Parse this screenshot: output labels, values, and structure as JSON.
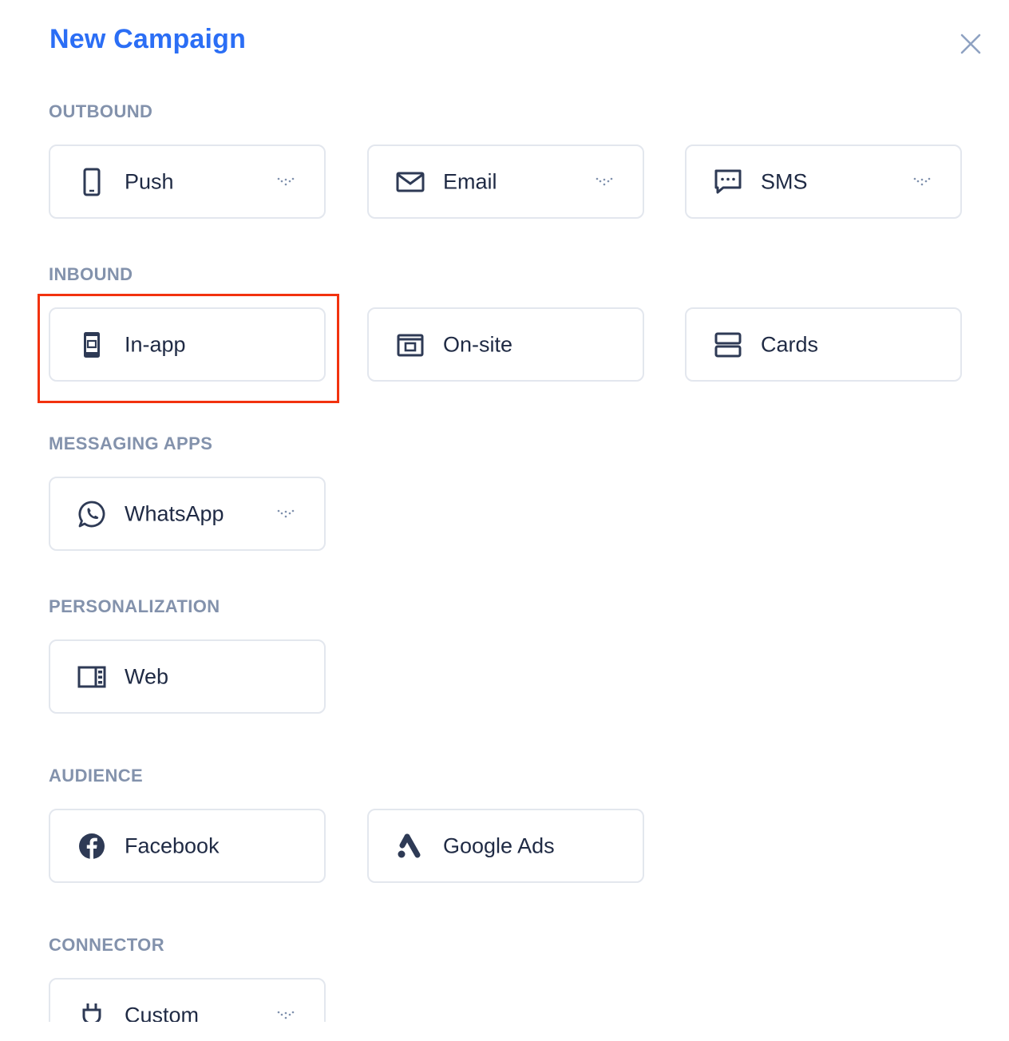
{
  "header": {
    "title": "New Campaign",
    "close_icon": "close-icon"
  },
  "colors": {
    "accent": "#2b6ef5",
    "section_label": "#8392ac",
    "card_border": "#e3e7ee",
    "highlight": "#f2320e",
    "text": "#1f2a44"
  },
  "sections": {
    "outbound": {
      "label": "OUTBOUND",
      "items": [
        {
          "label": "Push",
          "icon": "mobile-phone-icon",
          "has_dropdown": true
        },
        {
          "label": "Email",
          "icon": "envelope-icon",
          "has_dropdown": true
        },
        {
          "label": "SMS",
          "icon": "chat-bubble-icon",
          "has_dropdown": true
        }
      ]
    },
    "inbound": {
      "label": "INBOUND",
      "items": [
        {
          "label": "In-app",
          "icon": "in-app-message-icon",
          "has_dropdown": false,
          "highlighted": true
        },
        {
          "label": "On-site",
          "icon": "browser-window-icon",
          "has_dropdown": false
        },
        {
          "label": "Cards",
          "icon": "stacked-cards-icon",
          "has_dropdown": false
        }
      ]
    },
    "messaging_apps": {
      "label": "MESSAGING APPS",
      "items": [
        {
          "label": "WhatsApp",
          "icon": "whatsapp-icon",
          "has_dropdown": true
        }
      ]
    },
    "personalization": {
      "label": "PERSONALIZATION",
      "items": [
        {
          "label": "Web",
          "icon": "web-layout-icon",
          "has_dropdown": false
        }
      ]
    },
    "audience": {
      "label": "AUDIENCE",
      "items": [
        {
          "label": "Facebook",
          "icon": "facebook-icon",
          "has_dropdown": false
        },
        {
          "label": "Google Ads",
          "icon": "google-ads-icon",
          "has_dropdown": false
        }
      ]
    },
    "connector": {
      "label": "CONNECTOR",
      "items": [
        {
          "label": "Custom",
          "icon": "plug-icon",
          "has_dropdown": true
        }
      ]
    }
  }
}
